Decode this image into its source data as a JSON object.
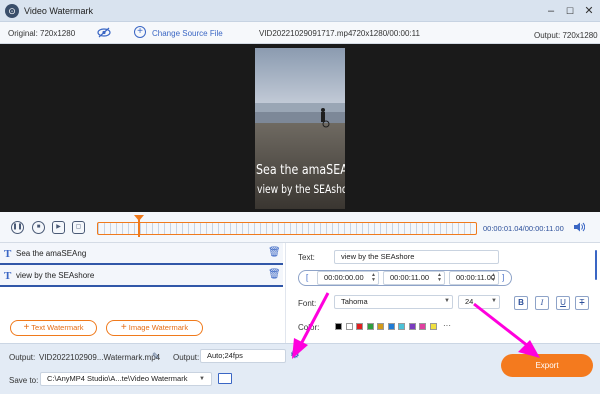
{
  "window": {
    "title": "Video Watermark",
    "min_label": "–",
    "max_label": "☐",
    "close_label": "✕"
  },
  "infobar": {
    "original": "Original: 720x1280",
    "change_source": "Change Source File",
    "file_name": "VID20221029091717.mp4",
    "file_info": "720x1280/00:00:11",
    "output": "Output: 720x1280"
  },
  "preview": {
    "line1": "Sea the amaSEAng",
    "line2": "view by the SEAshore"
  },
  "playback": {
    "time": "00:00:01.04/00:00:11.00"
  },
  "watermarks": [
    {
      "text": "Sea the amaSEAng"
    },
    {
      "text": "view by the SEAshore"
    }
  ],
  "buttons": {
    "add_text": "Text Watermark",
    "add_image": "Image Watermark",
    "export": "Export"
  },
  "editor": {
    "text_label": "Text:",
    "text_value": "view by the SEAshore",
    "time_start": "00:00:00.00",
    "time_mid": "00:00:11.00",
    "time_end": "00:00:11.00",
    "font_label": "Font:",
    "font_value": "Tahoma",
    "size_value": "24",
    "bold": "B",
    "italic": "I",
    "underline": "U",
    "strike": "T",
    "color_label": "Color:",
    "more_colors": "···"
  },
  "colors": [
    "#000000",
    "#ffffff",
    "#e02020",
    "#2e9e3e",
    "#d39a1a",
    "#1f7bd6",
    "#4cc2d8",
    "#7a3bbf",
    "#e040a0",
    "#f0e040"
  ],
  "bottom": {
    "output_label": "Output:",
    "output_file": "VID2022102909...Watermark.mp4",
    "output_label2": "Output:",
    "output_format": "Auto;24fps",
    "save_label": "Save to:",
    "save_path": "C:\\AnyMP4 Studio\\A...te\\Video Watermark"
  }
}
